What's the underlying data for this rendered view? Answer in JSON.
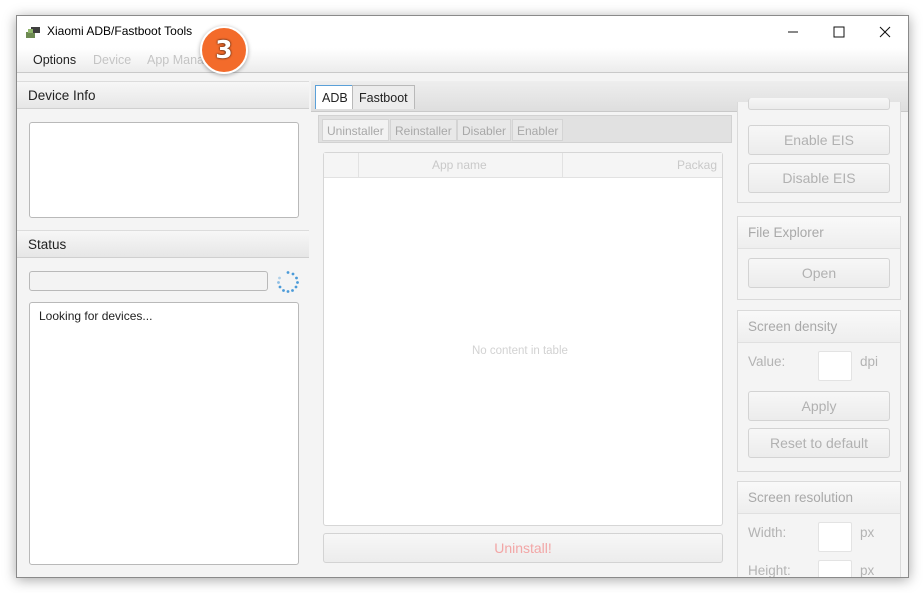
{
  "window": {
    "title": "Xiaomi ADB/Fastboot Tools",
    "step_badge": "3"
  },
  "menu": {
    "options": "Options",
    "device": "Device",
    "app_manager": "App Mana"
  },
  "left": {
    "device_info_header": "Device Info",
    "status_header": "Status",
    "status_text": "Looking for devices..."
  },
  "tabs": {
    "adb": "ADB",
    "fastboot": "Fastboot"
  },
  "subtabs": [
    "Uninstaller",
    "Reinstaller",
    "Disabler",
    "Enabler"
  ],
  "table": {
    "col_app_name": "App name",
    "col_package": "Packag",
    "empty_text": "No content in table"
  },
  "uninstall_button": "Uninstall!",
  "right": {
    "eis": {
      "enable": "Enable EIS",
      "disable": "Disable EIS"
    },
    "file_explorer": {
      "title": "File Explorer",
      "open": "Open"
    },
    "screen_density": {
      "title": "Screen density",
      "value_label": "Value:",
      "unit": "dpi",
      "apply": "Apply",
      "reset": "Reset to default"
    },
    "screen_resolution": {
      "title": "Screen resolution",
      "width_label": "Width:",
      "height_label": "Height:",
      "unit": "px"
    }
  },
  "colors": {
    "badge": "#f36b2b",
    "uninstall_text": "#f2a6a6",
    "active_tab_border": "#5aa0d8"
  }
}
